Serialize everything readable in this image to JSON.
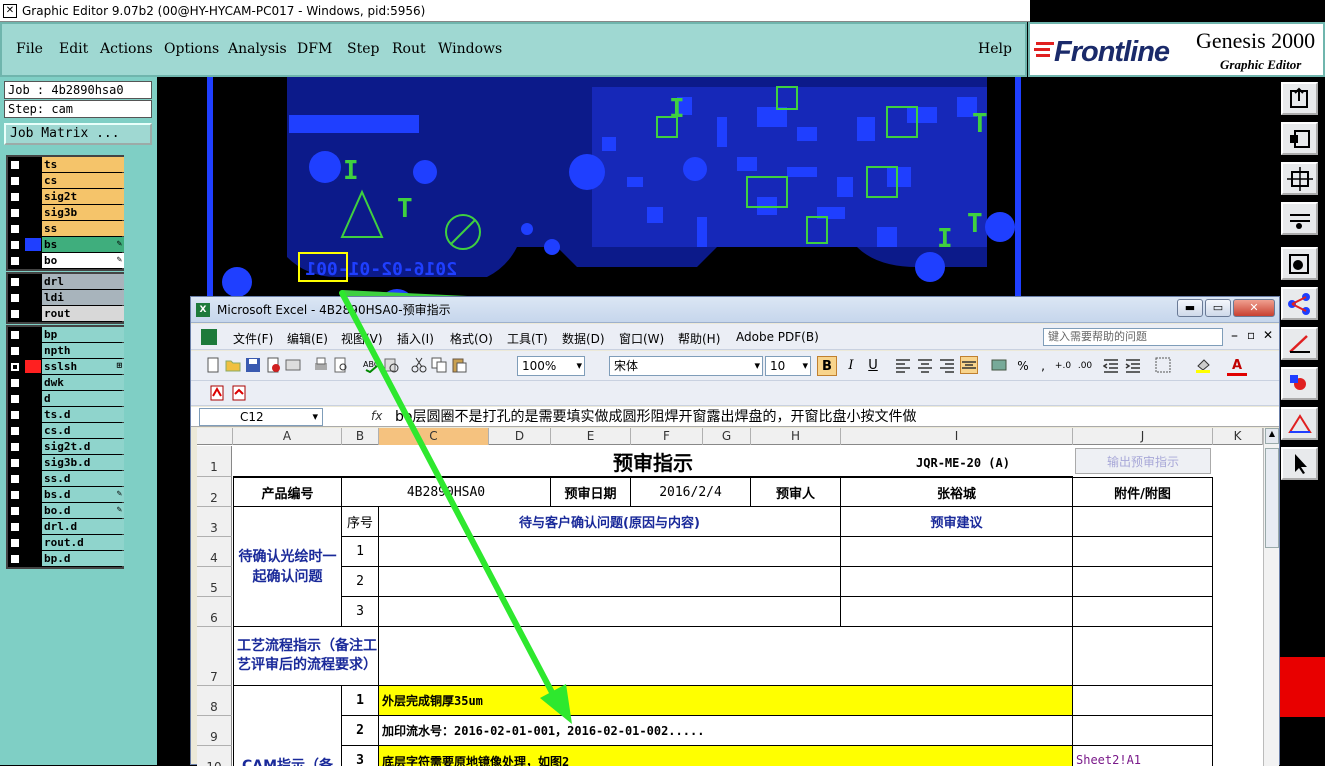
{
  "window": {
    "title": "Graphic Editor 9.07b2 (00@HY-HYCAM-PC017 - Windows, pid:5956)",
    "icon": "x-window-icon"
  },
  "genesis_menu": {
    "items": [
      "File",
      "Edit",
      "Actions",
      "Options",
      "Analysis",
      "DFM",
      "Step",
      "Rout",
      "Windows"
    ],
    "help": "Help"
  },
  "brand": {
    "logo": "Frontline",
    "product": "Genesis 2000",
    "subtitle": "Graphic Editor"
  },
  "job": {
    "job_label": "Job : 4b2890hsa0",
    "step_label": "Step: cam",
    "matrix_button": "Job Matrix ..."
  },
  "layers": {
    "group1": [
      {
        "name": "ts",
        "color": "#f5c46a",
        "swatch": "#000000",
        "checked": false,
        "mark": ""
      },
      {
        "name": "cs",
        "color": "#f5c46a",
        "swatch": "#000000",
        "checked": false,
        "mark": ""
      },
      {
        "name": "sig2t",
        "color": "#f5c46a",
        "swatch": "#000000",
        "checked": false,
        "mark": ""
      },
      {
        "name": "sig3b",
        "color": "#f5c46a",
        "swatch": "#000000",
        "checked": false,
        "mark": ""
      },
      {
        "name": "ss",
        "color": "#f5c46a",
        "swatch": "#000000",
        "checked": false,
        "mark": ""
      },
      {
        "name": "bs",
        "color": "#3fae7d",
        "swatch": "#1f3fff",
        "checked": false,
        "mark": "✎"
      },
      {
        "name": "bo",
        "color": "#ffffff",
        "swatch": "#000000",
        "checked": false,
        "mark": "✎"
      }
    ],
    "group2": [
      {
        "name": "drl",
        "color": "#a8b4bc",
        "swatch": "#000000",
        "checked": false,
        "mark": ""
      },
      {
        "name": "ldi",
        "color": "#a8b4bc",
        "swatch": "#000000",
        "checked": false,
        "mark": ""
      },
      {
        "name": "rout",
        "color": "#d8d8d8",
        "swatch": "#000000",
        "checked": false,
        "mark": ""
      }
    ],
    "group3": [
      {
        "name": "bp",
        "color": "#8fd4cc",
        "swatch": "#000000",
        "checked": false,
        "mark": ""
      },
      {
        "name": "npth",
        "color": "#8fd4cc",
        "swatch": "#000000",
        "checked": false,
        "mark": ""
      },
      {
        "name": "sslsh",
        "color": "#8fd4cc",
        "swatch": "#ff2020",
        "checked": true,
        "mark": "⊞"
      },
      {
        "name": "dwk",
        "color": "#8fd4cc",
        "swatch": "#000000",
        "checked": false,
        "mark": ""
      },
      {
        "name": "d",
        "color": "#8fd4cc",
        "swatch": "#000000",
        "checked": false,
        "mark": ""
      },
      {
        "name": "ts.d",
        "color": "#8fd4cc",
        "swatch": "#000000",
        "checked": false,
        "mark": ""
      },
      {
        "name": "cs.d",
        "color": "#8fd4cc",
        "swatch": "#000000",
        "checked": false,
        "mark": ""
      },
      {
        "name": "sig2t.d",
        "color": "#8fd4cc",
        "swatch": "#000000",
        "checked": false,
        "mark": ""
      },
      {
        "name": "sig3b.d",
        "color": "#8fd4cc",
        "swatch": "#000000",
        "checked": false,
        "mark": ""
      },
      {
        "name": "ss.d",
        "color": "#8fd4cc",
        "swatch": "#000000",
        "checked": false,
        "mark": ""
      },
      {
        "name": "bs.d",
        "color": "#8fd4cc",
        "swatch": "#000000",
        "checked": false,
        "mark": "✎"
      },
      {
        "name": "bo.d",
        "color": "#8fd4cc",
        "swatch": "#000000",
        "checked": false,
        "mark": "✎"
      },
      {
        "name": "drl.d",
        "color": "#8fd4cc",
        "swatch": "#000000",
        "checked": false,
        "mark": ""
      },
      {
        "name": "rout.d",
        "color": "#8fd4cc",
        "swatch": "#000000",
        "checked": false,
        "mark": ""
      },
      {
        "name": "bp.d",
        "color": "#8fd4cc",
        "swatch": "#000000",
        "checked": false,
        "mark": ""
      }
    ]
  },
  "canvas": {
    "mirror_text": "2016-02-01-001",
    "layer_color": "#1f3fff",
    "outline_color": "#3fd040",
    "highlight": "#ffff00"
  },
  "excel": {
    "title": "Microsoft Excel - 4B2890HSA0-预审指示",
    "menu": [
      "文件(F)",
      "编辑(E)",
      "视图(V)",
      "插入(I)",
      "格式(O)",
      "工具(T)",
      "数据(D)",
      "窗口(W)",
      "帮助(H)",
      "Adobe PDF(B)"
    ],
    "help_placeholder": "键入需要帮助的问题",
    "zoom": "100%",
    "font": "宋体",
    "font_size": "10",
    "cell_ref": "C12",
    "fx": "fx",
    "formula": "bo层圆圈不是打孔的是需要填实做成圆形阻焊开窗露出焊盘的，开窗比盘小按文件做",
    "columns": [
      "A",
      "B",
      "C",
      "D",
      "E",
      "F",
      "G",
      "H",
      "I",
      "J",
      "K"
    ],
    "rows": [
      "1",
      "2",
      "3",
      "4",
      "5",
      "6",
      "7",
      "8",
      "9",
      "10"
    ],
    "sheet": {
      "title": "预审指示",
      "code": "JQR-ME-20 (A)",
      "output_button": "输出预审指示",
      "product_label": "产品编号",
      "product_value": "4B2890HSA0",
      "date_label": "预审日期",
      "date_value": "2016/2/4",
      "reviewer_label": "预审人",
      "reviewer_value": "张裕城",
      "attach_label": "附件/附图",
      "pending_label": "待确认光绘时一起确认问题",
      "seq_label": "序号",
      "issue_label": "待与客户确认问题(原因与内容)",
      "advice_label": "预审建议",
      "seq": [
        "1",
        "2",
        "3"
      ],
      "process_label": "工艺流程指示（备注工艺评审后的流程要求）",
      "cam_label": "CAM指示（备",
      "cam_items": [
        {
          "no": "1",
          "text": "外层完成铜厚35um",
          "yellow": true
        },
        {
          "no": "2",
          "text": "加印流水号：2016-02-01-001，2016-02-01-002.....",
          "yellow": false
        },
        {
          "no": "3",
          "text": "底层字符需要原地镜像处理，如图2",
          "yellow": true
        }
      ],
      "sheet_link": "Sheet2!A1"
    }
  }
}
